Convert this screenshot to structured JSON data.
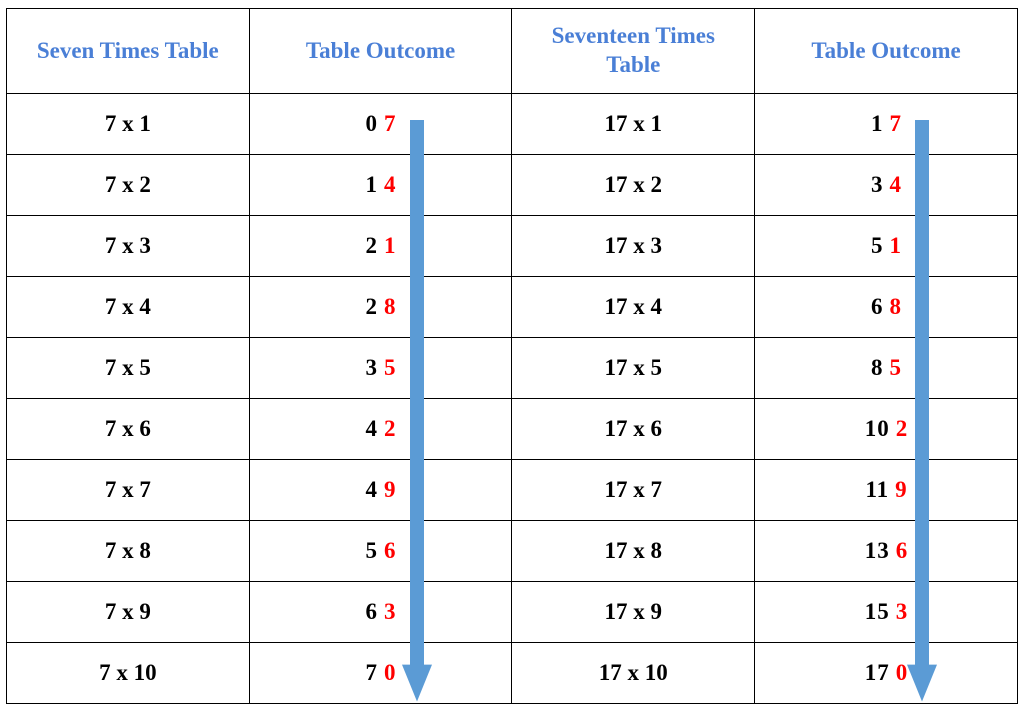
{
  "headers": {
    "col1": "Seven Times Table",
    "col2": "Table Outcome",
    "col3": "Seventeen Times\nTable",
    "col4": "Table Outcome"
  },
  "arrow_color": "#5b9bd5",
  "chart_data": {
    "type": "table",
    "title": "Comparison of Seven and Seventeen Times Tables",
    "columns": [
      "Seven Times Table",
      "Table Outcome",
      "Seventeen Times Table",
      "Table Outcome"
    ],
    "rows": [
      {
        "seven_expr": "7 x 1",
        "seven_tens": "0",
        "seven_unit": "7",
        "seventeen_expr": "17 x 1",
        "seventeen_tens": "1",
        "seventeen_unit": "7"
      },
      {
        "seven_expr": "7 x 2",
        "seven_tens": "1",
        "seven_unit": "4",
        "seventeen_expr": "17 x 2",
        "seventeen_tens": "3",
        "seventeen_unit": "4"
      },
      {
        "seven_expr": "7 x 3",
        "seven_tens": "2",
        "seven_unit": "1",
        "seventeen_expr": "17 x 3",
        "seventeen_tens": "5",
        "seventeen_unit": "1"
      },
      {
        "seven_expr": "7 x 4",
        "seven_tens": "2",
        "seven_unit": "8",
        "seventeen_expr": "17 x 4",
        "seventeen_tens": "6",
        "seventeen_unit": "8"
      },
      {
        "seven_expr": "7 x 5",
        "seven_tens": "3",
        "seven_unit": "5",
        "seventeen_expr": "17 x 5",
        "seventeen_tens": "8",
        "seventeen_unit": "5"
      },
      {
        "seven_expr": "7 x 6",
        "seven_tens": "4",
        "seven_unit": "2",
        "seventeen_expr": "17 x 6",
        "seventeen_tens": "10",
        "seventeen_unit": "2"
      },
      {
        "seven_expr": "7 x 7",
        "seven_tens": "4",
        "seven_unit": "9",
        "seventeen_expr": "17 x 7",
        "seventeen_tens": "11",
        "seventeen_unit": "9"
      },
      {
        "seven_expr": "7 x 8",
        "seven_tens": "5",
        "seven_unit": "6",
        "seventeen_expr": "17 x 8",
        "seventeen_tens": "13",
        "seventeen_unit": "6"
      },
      {
        "seven_expr": "7 x 9",
        "seven_tens": "6",
        "seven_unit": "3",
        "seventeen_expr": "17 x 9",
        "seventeen_tens": "15",
        "seventeen_unit": "3"
      },
      {
        "seven_expr": "7 x 10",
        "seven_tens": "7",
        "seven_unit": "0",
        "seventeen_expr": "17 x 10",
        "seventeen_tens": "17",
        "seventeen_unit": "0"
      }
    ]
  }
}
